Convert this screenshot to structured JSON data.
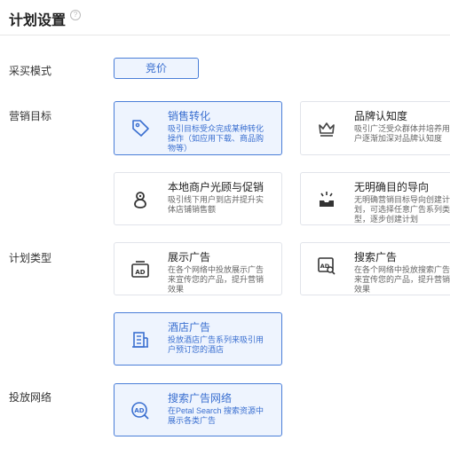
{
  "header": {
    "title": "计划设置",
    "help_icon": "help-circle-icon"
  },
  "labels": {
    "purchase_mode": "采买模式",
    "marketing_goal": "营销目标",
    "plan_type": "计划类型",
    "network": "投放网络"
  },
  "purchase_mode": {
    "selected_label": "竞价"
  },
  "marketing_goals": [
    {
      "title": "销售转化",
      "desc": "吸引目标受众完成某种转化操作（如应用下载、商品购物等）",
      "selected": true,
      "icon": "tag-icon"
    },
    {
      "title": "品牌认知度",
      "desc": "吸引广泛受众群体并培养用户逐渐加深对品牌认知度",
      "selected": false,
      "icon": "crown-icon"
    },
    {
      "title": "本地商户光顾与促销",
      "desc": "吸引线下用户到店并提升实体店铺销售额",
      "selected": false,
      "icon": "location-pin-icon"
    },
    {
      "title": "无明确目的导向",
      "desc": "无明确营销目标导向创建计划，可选择任意广告系列类型，逐步创建计划",
      "selected": false,
      "icon": "inbox-icon"
    }
  ],
  "plan_types": [
    {
      "title": "展示广告",
      "desc": "在各个网络中投放展示广告来宣传您的产品，提升营销效果",
      "selected": false,
      "icon": "ad-display-icon"
    },
    {
      "title": "搜索广告",
      "desc": "在各个网络中投放搜索广告来宣传您的产品，提升营销效果",
      "selected": false,
      "icon": "ad-search-icon"
    },
    {
      "title": "酒店广告",
      "desc": "投放酒店广告系列来吸引用户预订您的酒店",
      "selected": true,
      "icon": "hotel-icon"
    }
  ],
  "networks": [
    {
      "title": "搜索广告网络",
      "desc": "在Petal Search 搜索资源中展示各类广告",
      "selected": true,
      "icon": "ad-search-network-icon"
    }
  ],
  "colors": {
    "accent": "#4a7ed8",
    "selected_bg": "#eef4fe"
  }
}
